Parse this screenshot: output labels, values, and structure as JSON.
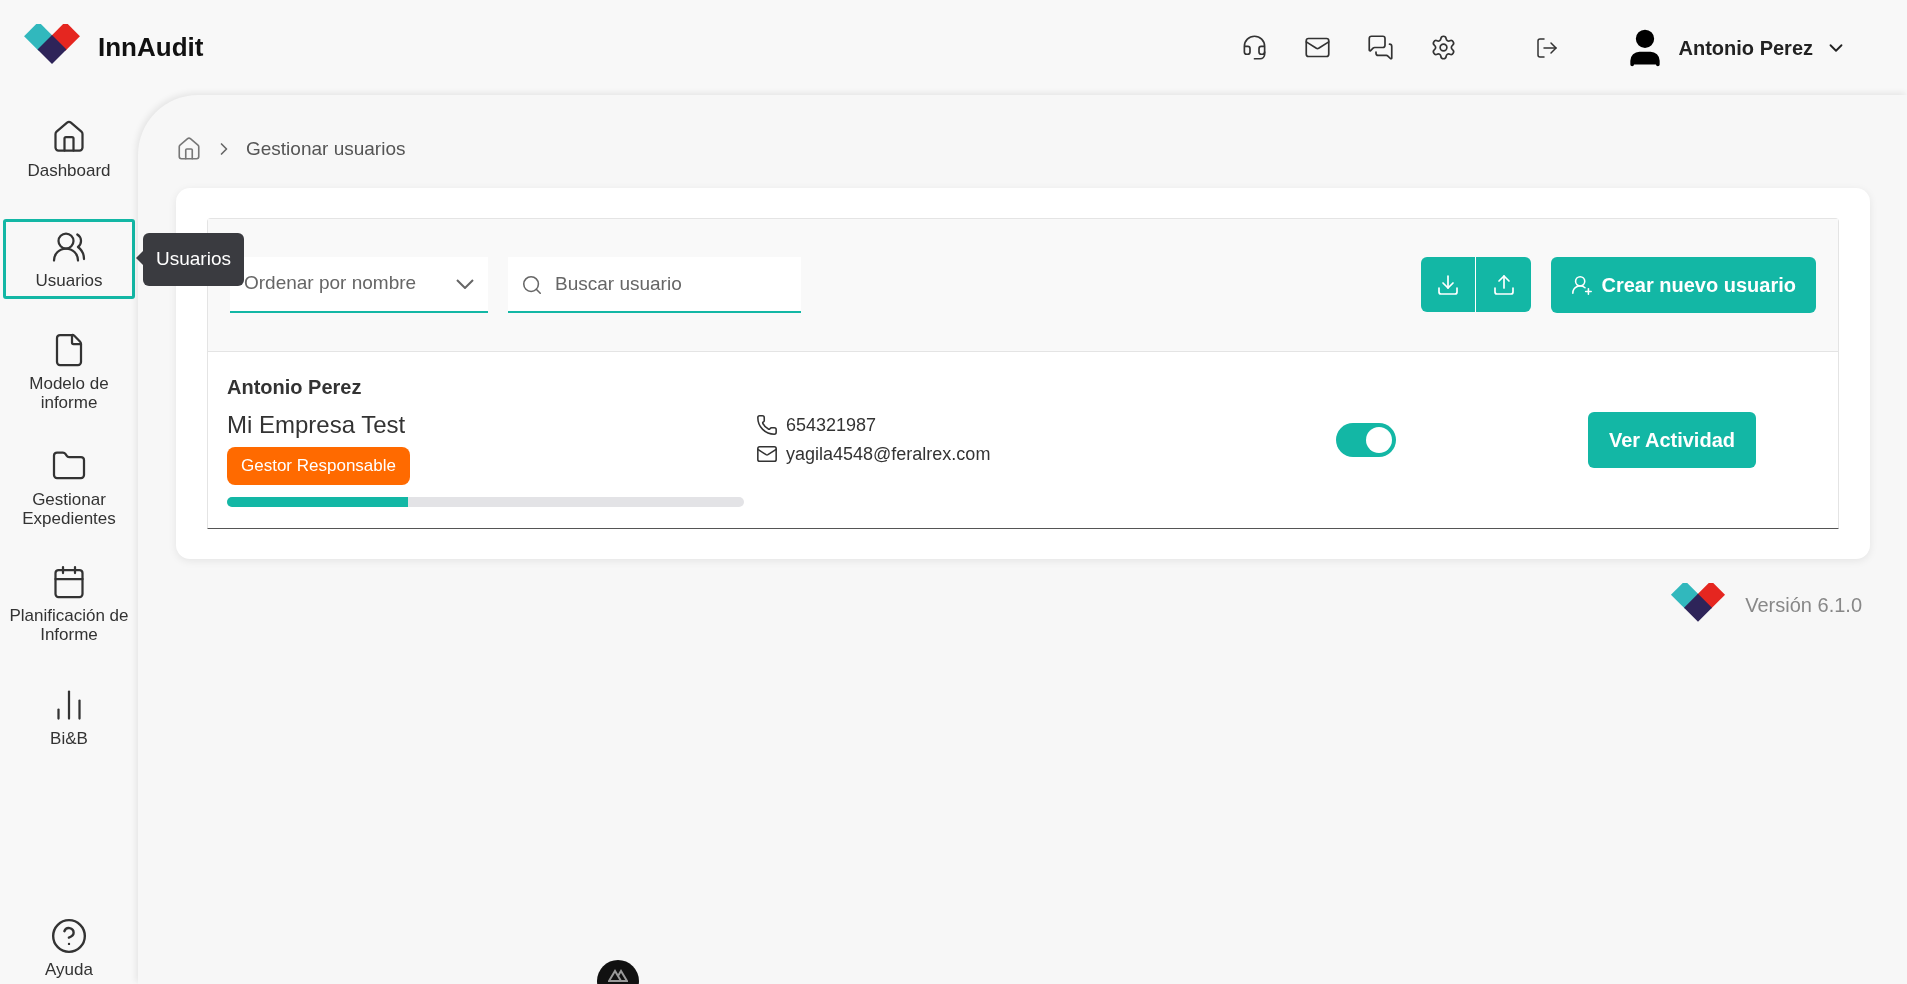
{
  "header": {
    "app_name": "InnAudit",
    "user_name": "Antonio Perez"
  },
  "sidebar": {
    "items": [
      {
        "kind": "home",
        "label": "Dashboard",
        "selected": false
      },
      {
        "kind": "users",
        "label": "Usuarios",
        "selected": true
      },
      {
        "kind": "file",
        "label": "Modelo de informe",
        "selected": false
      },
      {
        "kind": "folder",
        "label": "Gestionar Expedientes",
        "selected": false
      },
      {
        "kind": "calendar",
        "label": "Planificación de Informe",
        "selected": false
      },
      {
        "kind": "chart",
        "label": "Bi&B",
        "selected": false
      }
    ],
    "help": "Ayuda"
  },
  "tooltip": "Usuarios",
  "breadcrumb": [
    "Gestionar usuarios"
  ],
  "toolbar": {
    "sort": "Ordenar por nombre",
    "search": {
      "placeholder": "Buscar usuario"
    },
    "create_button": "Crear nuevo usuario"
  },
  "users": [
    {
      "name": "Antonio Perez",
      "company": "Mi Empresa Test",
      "role": "Gestor Responsable",
      "level": 0.35,
      "phone": "654321987",
      "email": "yagila4548@feralrex.com",
      "active": true,
      "action": "Ver Actividad"
    }
  ],
  "footer": {
    "version": "Versión 6.1.0"
  }
}
